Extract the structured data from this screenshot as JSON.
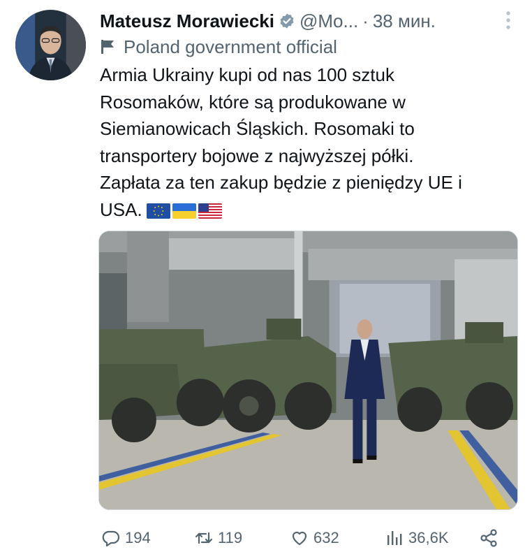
{
  "author": {
    "display_name": "Mateusz Morawiecki",
    "handle": "@Mo...",
    "separator": "·",
    "time": "38 мин.",
    "affiliation": "Poland government official"
  },
  "tweet": {
    "text": "Armia Ukrainy kupi od nas 100 sztuk\nRosomaków, które są produkowane w\nSiemianowicach Śląskich. Rosomaki to\ntransportery bojowe z najwyższej półki.\nZapłata za ten zakup będzie z pieniędzy UE i\nUSA.",
    "emoji_flags": [
      "eu-flag-icon",
      "ukraine-flag-icon",
      "usa-flag-icon"
    ]
  },
  "stats": {
    "replies": "194",
    "retweets": "119",
    "likes": "632",
    "views": "36,6K"
  },
  "colors": {
    "text": "#0f1419",
    "secondary": "#536471",
    "verified_badge": "#829aab"
  },
  "icons": {
    "verified": "verified-badge-icon",
    "more": "more-vertical-icon",
    "affiliation": "flag-icon",
    "reply": "reply-icon",
    "retweet": "retweet-icon",
    "like": "heart-icon",
    "views": "views-chart-icon",
    "share": "share-icon"
  }
}
